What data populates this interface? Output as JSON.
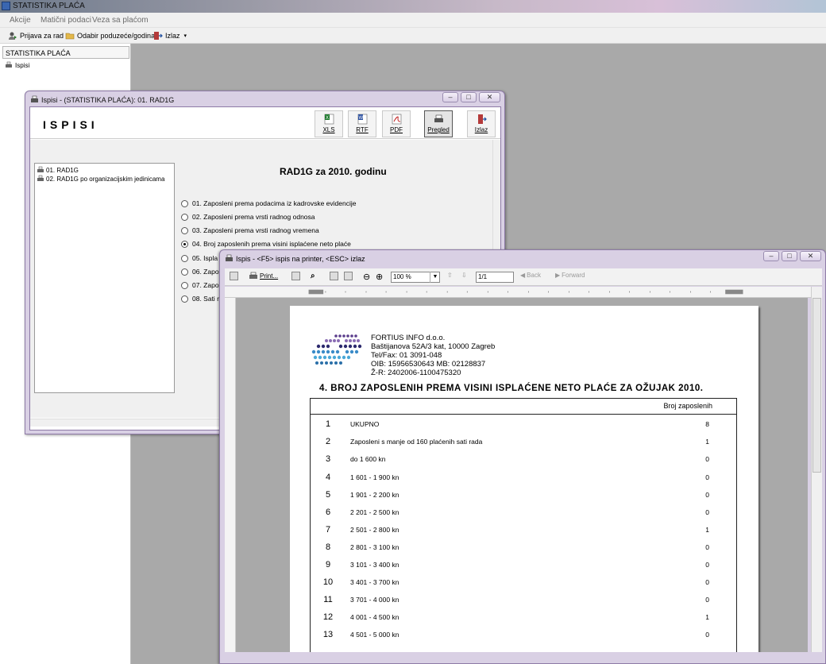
{
  "app": {
    "title": "STATISTIKA PLAĆA",
    "menu": [
      "Akcije",
      "Matični podaci",
      "Veza sa plaćom"
    ],
    "toolbar": {
      "prijava": "Prijava za rad",
      "odabir": "Odabir poduzeće/godina",
      "izlaz": "Izlaz"
    },
    "sidebar": {
      "header": "STATISTIKA PLAĆA",
      "item": "Ispisi"
    }
  },
  "win1": {
    "title": "Ispisi - (STATISTIKA PLAĆA): 01. RAD1G",
    "heading": "ISPISI",
    "buttons": {
      "xls": "XLS",
      "rtf": "RTF",
      "pdf": "PDF",
      "pregled": "Pregled",
      "izlaz": "Izlaz"
    },
    "list": [
      "01. RAD1G",
      "02. RAD1G po organizacijskim jedinicama"
    ],
    "report_title": "RAD1G za 2010. godinu",
    "options": [
      "01. Zaposleni prema podacima iz kadrovske evidencije",
      "02. Zaposleni prema vrsti radnog odnosa",
      "03. Zaposleni prema vrsti radnog vremena",
      "04. Broj zaposlenih prema visini isplaćene neto plaće",
      "05. Ispla",
      "06. Zapo",
      "07. Zapo",
      "08. Sati r"
    ],
    "selected_option": 4
  },
  "win2": {
    "title": "Ispis - <F5> ispis na printer, <ESC> izlaz",
    "tools": {
      "print": "Print...",
      "zoom": "100 %",
      "page": "1/1",
      "back": "Back",
      "forward": "Forward"
    },
    "company": [
      "FORTIUS INFO d.o.o.",
      "Baštijanova 52A/3 kat, 10000 Zagreb",
      "Tel/Fax: 01 3091-048",
      "OIB: 15956530643   MB: 02128837",
      "Ž-R: 2402006-1100475320"
    ],
    "report_title": "4. BROJ ZAPOSLENIH PREMA VISINI ISPLAĆENE NETO PLAĆE ZA OŽUJAK 2010.",
    "col_header": "Broj zaposlenih",
    "rows": [
      {
        "n": "1",
        "label": "UKUPNO",
        "value": "8"
      },
      {
        "n": "2",
        "label": "Zaposleni s manje od 160 plaćenih sati rada",
        "value": "1"
      },
      {
        "n": "3",
        "label": "do 1 600 kn",
        "value": "0"
      },
      {
        "n": "4",
        "label": "1 601 - 1 900 kn",
        "value": "0"
      },
      {
        "n": "5",
        "label": "1 901 - 2 200 kn",
        "value": "0"
      },
      {
        "n": "6",
        "label": "2 201 - 2 500 kn",
        "value": "0"
      },
      {
        "n": "7",
        "label": "2 501 - 2 800 kn",
        "value": "1"
      },
      {
        "n": "8",
        "label": "2 801 - 3 100 kn",
        "value": "0"
      },
      {
        "n": "9",
        "label": "3 101 - 3 400 kn",
        "value": "0"
      },
      {
        "n": "10",
        "label": "3 401 - 3 700 kn",
        "value": "0"
      },
      {
        "n": "11",
        "label": "3 701 - 4 000 kn",
        "value": "0"
      },
      {
        "n": "12",
        "label": "4 001 - 4 500 kn",
        "value": "1"
      },
      {
        "n": "13",
        "label": "4 501 - 5 000 kn",
        "value": "0"
      }
    ]
  }
}
